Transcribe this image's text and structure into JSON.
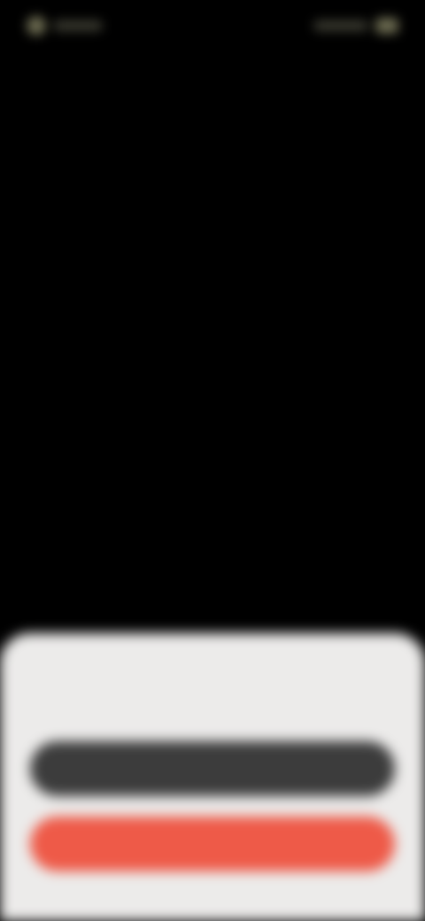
{
  "status_bar": {
    "signal_icon": "signal-icon",
    "battery_icon": "battery-icon"
  },
  "sheet": {
    "message": "",
    "secondary_button_label": "",
    "primary_button_label": ""
  },
  "colors": {
    "background": "#000000",
    "sheet": "#ecebea",
    "secondary_button": "#3c3c3c",
    "primary_button": "#ee5a48"
  }
}
